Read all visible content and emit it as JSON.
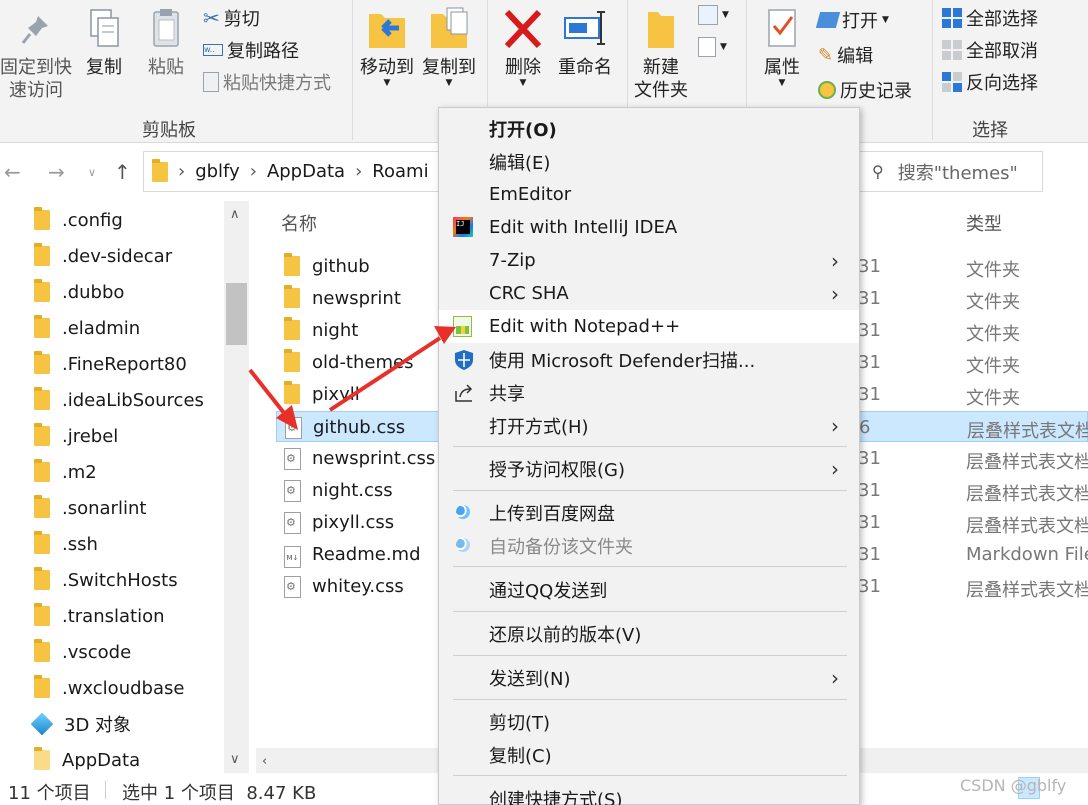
{
  "ribbon": {
    "clipboard": {
      "pin_label_1": "固定到快",
      "pin_label_2": "速访问",
      "copy": "复制",
      "paste": "粘贴",
      "cut": "剪切",
      "copy_path": "复制路径",
      "paste_shortcut": "粘贴快捷方式",
      "group": "剪贴板"
    },
    "organize": {
      "move_to": "移动到",
      "copy_to": "复制到",
      "delete": "删除",
      "rename": "重命名"
    },
    "new": {
      "new_folder_1": "新建",
      "new_folder_2": "文件夹"
    },
    "open": {
      "properties": "属性",
      "open": "打开",
      "edit": "编辑",
      "history": "历史记录"
    },
    "select": {
      "select_all": "全部选择",
      "select_none": "全部取消",
      "invert": "反向选择",
      "group": "选择"
    }
  },
  "address": {
    "crumbs": [
      "gblfy",
      "AppData",
      "Roami"
    ],
    "search_placeholder": "搜索\"themes\""
  },
  "nav": {
    "items": [
      ".config",
      ".dev-sidecar",
      ".dubbo",
      ".eladmin",
      ".FineReport80",
      ".ideaLibSources",
      ".jrebel",
      ".m2",
      ".sonarlint",
      ".ssh",
      ".SwitchHosts",
      ".translation",
      ".vscode",
      ".wxcloudbase",
      "3D 对象",
      "AppData"
    ]
  },
  "files": {
    "headers": {
      "name": "名称",
      "type": "类型"
    },
    "rows": [
      {
        "name": "github",
        "date": "31",
        "type": "文件夹",
        "kind": "folder"
      },
      {
        "name": "newsprint",
        "date": "31",
        "type": "文件夹",
        "kind": "folder"
      },
      {
        "name": "night",
        "date": "31",
        "type": "文件夹",
        "kind": "folder"
      },
      {
        "name": "old-themes",
        "date": "31",
        "type": "文件夹",
        "kind": "folder"
      },
      {
        "name": "pixyll",
        "date": "31",
        "type": "文件夹",
        "kind": "folder"
      },
      {
        "name": "github.css",
        "date": "6",
        "type": "层叠样式表文档",
        "kind": "css",
        "selected": true
      },
      {
        "name": "newsprint.css",
        "date": "31",
        "type": "层叠样式表文档",
        "kind": "css"
      },
      {
        "name": "night.css",
        "date": "31",
        "type": "层叠样式表文档",
        "kind": "css"
      },
      {
        "name": "pixyll.css",
        "date": "31",
        "type": "层叠样式表文档",
        "kind": "css"
      },
      {
        "name": "Readme.md",
        "date": "31",
        "type": "Markdown File",
        "kind": "md"
      },
      {
        "name": "whitey.css",
        "date": "31",
        "type": "层叠样式表文档",
        "kind": "css"
      }
    ]
  },
  "status": {
    "count": "11 个项目",
    "selection": "选中 1 个项目  8.47 KB"
  },
  "context_menu": {
    "items": [
      {
        "label": "打开(O)"
      },
      {
        "label": "编辑(E)"
      },
      {
        "label": "EmEditor"
      },
      {
        "label": "Edit with IntelliJ IDEA"
      },
      {
        "label": "7-Zip"
      },
      {
        "label": "CRC SHA"
      },
      {
        "label": "Edit with Notepad++"
      },
      {
        "label": "使用 Microsoft Defender扫描..."
      },
      {
        "label": "共享"
      },
      {
        "label": "打开方式(H)"
      },
      {
        "label": "授予访问权限(G)"
      },
      {
        "label": "上传到百度网盘"
      },
      {
        "label": "自动备份该文件夹"
      },
      {
        "label": "通过QQ发送到"
      },
      {
        "label": "还原以前的版本(V)"
      },
      {
        "label": "发送到(N)"
      },
      {
        "label": "剪切(T)"
      },
      {
        "label": "复制(C)"
      },
      {
        "label": "创建快捷方式(S)"
      }
    ]
  },
  "watermark": "CSDN @gblfy",
  "colors": {
    "accent_arrow": "#e8302a",
    "selection_bg": "#cce8ff",
    "folder": "#f6c343"
  }
}
